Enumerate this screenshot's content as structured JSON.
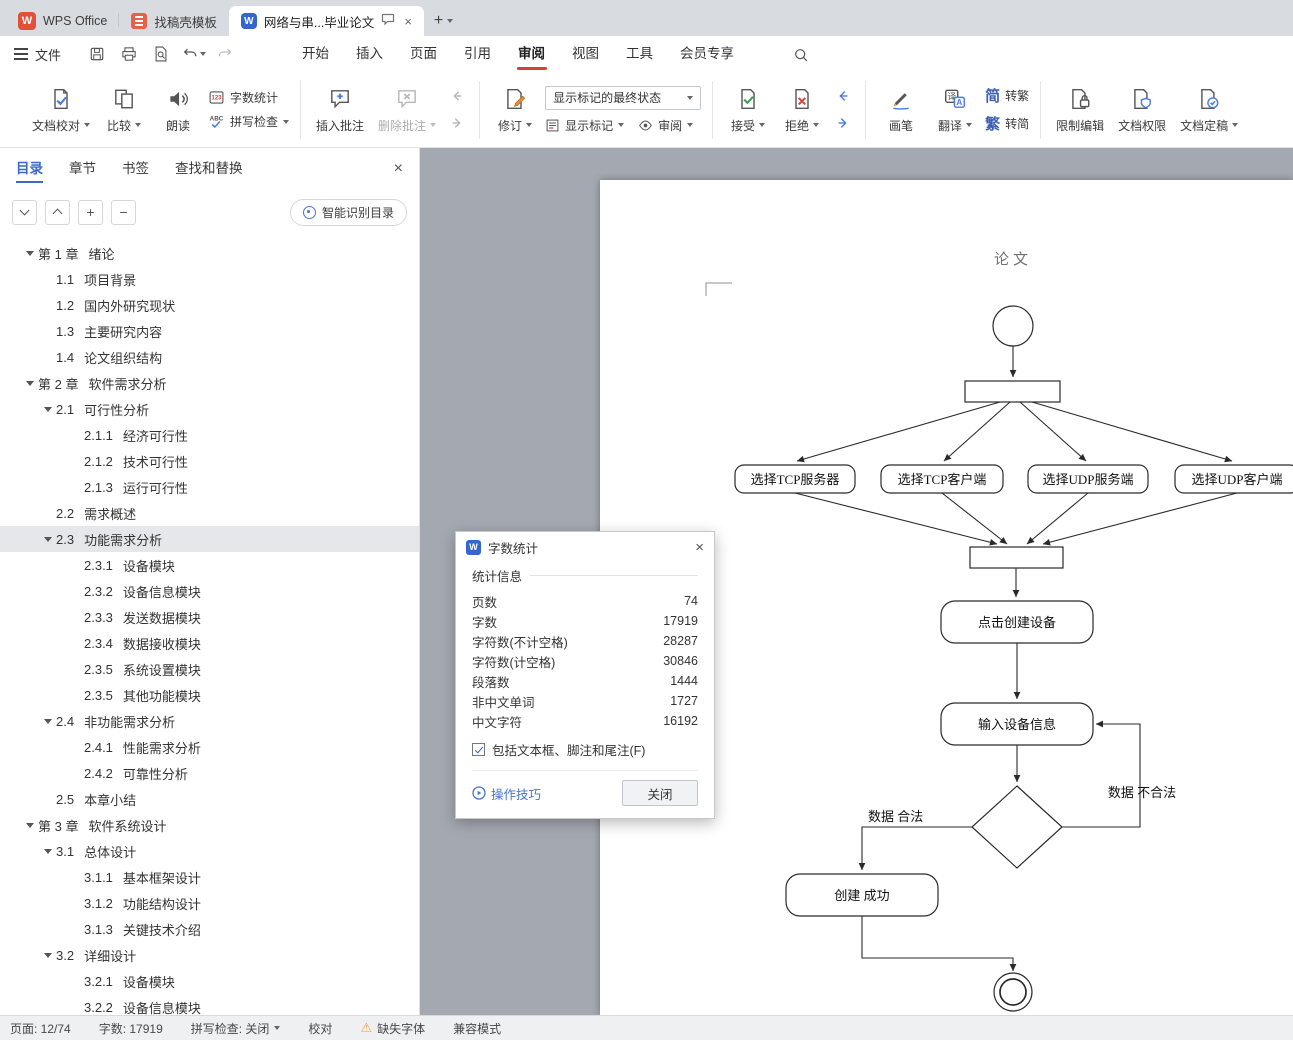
{
  "icons": {
    "w": "W",
    "abc": "ABC",
    "count": "123",
    "yi": "译",
    "a": "A",
    "warning": "⚠",
    "plus": "+",
    "minus": "−",
    "close": "×"
  },
  "tabbar": {
    "tabs": [
      {
        "label": "WPS Office"
      },
      {
        "label": "找稿壳模板"
      },
      {
        "label": "网络与串...毕业论文",
        "active": true
      }
    ]
  },
  "menubar": {
    "file": "文件",
    "items": [
      {
        "label": "开始"
      },
      {
        "label": "插入"
      },
      {
        "label": "页面"
      },
      {
        "label": "引用"
      },
      {
        "label": "审阅",
        "active": true
      },
      {
        "label": "视图"
      },
      {
        "label": "工具"
      },
      {
        "label": "会员专享"
      }
    ]
  },
  "ribbon": {
    "doc_proof": "文档校对",
    "compare": "比较",
    "read": "朗读",
    "word_count": "字数统计",
    "spell": "拼写检查",
    "insert_comment": "插入批注",
    "delete_comment": "删除批注",
    "revise": "修订",
    "markup_state": "显示标记的最终状态",
    "show_markup": "显示标记",
    "review": "审阅",
    "accept": "接受",
    "reject": "拒绝",
    "pen": "画笔",
    "translate": "翻译",
    "jian": "简",
    "fan": "繁",
    "s2t": "转繁",
    "t2s": "转简",
    "restrict": "限制编辑",
    "permission": "文档权限",
    "finalize": "文档定稿"
  },
  "sidebar": {
    "tabs": [
      {
        "label": "目录",
        "active": true
      },
      {
        "label": "章节"
      },
      {
        "label": "书签"
      },
      {
        "label": "查找和替换"
      }
    ],
    "smart_toc": "智能识别目录",
    "toc": [
      {
        "level": 1,
        "caret": true,
        "num": "第 1 章",
        "title": "绪论"
      },
      {
        "level": 2,
        "num": "1.1",
        "title": "项目背景"
      },
      {
        "level": 2,
        "num": "1.2",
        "title": "国内外研究现状"
      },
      {
        "level": 2,
        "num": "1.3",
        "title": "主要研究内容"
      },
      {
        "level": 2,
        "num": "1.4",
        "title": "论文组织结构"
      },
      {
        "level": 1,
        "caret": true,
        "num": "第 2 章",
        "title": "软件需求分析"
      },
      {
        "level": 2,
        "caret": true,
        "num": "2.1",
        "title": "可行性分析"
      },
      {
        "level": 3,
        "num": "2.1.1",
        "title": "经济可行性"
      },
      {
        "level": 3,
        "num": "2.1.2",
        "title": "技术可行性"
      },
      {
        "level": 3,
        "num": "2.1.3",
        "title": "运行可行性"
      },
      {
        "level": 2,
        "num": "2.2",
        "title": "需求概述"
      },
      {
        "level": 2,
        "caret": true,
        "selected": true,
        "num": "2.3",
        "title": "功能需求分析"
      },
      {
        "level": 3,
        "num": "2.3.1",
        "title": "设备模块"
      },
      {
        "level": 3,
        "num": "2.3.2",
        "title": "设备信息模块"
      },
      {
        "level": 3,
        "num": "2.3.3",
        "title": "发送数据模块"
      },
      {
        "level": 3,
        "num": "2.3.4",
        "title": "数据接收模块"
      },
      {
        "level": 3,
        "num": "2.3.5",
        "title": "系统设置模块"
      },
      {
        "level": 3,
        "num": "2.3.5",
        "title": "其他功能模块"
      },
      {
        "level": 2,
        "caret": true,
        "num": "2.4",
        "title": "非功能需求分析"
      },
      {
        "level": 3,
        "num": "2.4.1",
        "title": "性能需求分析"
      },
      {
        "level": 3,
        "num": "2.4.2",
        "title": "可靠性分析"
      },
      {
        "level": 2,
        "num": "2.5",
        "title": "本章小结"
      },
      {
        "level": 1,
        "caret": true,
        "num": "第 3 章",
        "title": "软件系统设计"
      },
      {
        "level": 2,
        "caret": true,
        "num": "3.1",
        "title": "总体设计"
      },
      {
        "level": 3,
        "num": "3.1.1",
        "title": "基本框架设计"
      },
      {
        "level": 3,
        "num": "3.1.2",
        "title": "功能结构设计"
      },
      {
        "level": 3,
        "num": "3.1.3",
        "title": "关键技术介绍"
      },
      {
        "level": 2,
        "caret": true,
        "num": "3.2",
        "title": "详细设计"
      },
      {
        "level": 3,
        "num": "3.2.1",
        "title": "设备模块"
      },
      {
        "level": 3,
        "num": "3.2.2",
        "title": "设备信息模块"
      }
    ]
  },
  "dialog": {
    "title": "字数统计",
    "section": "统计信息",
    "stats": [
      {
        "label": "页数",
        "value": "74"
      },
      {
        "label": "字数",
        "value": "17919"
      },
      {
        "label": "字符数(不计空格)",
        "value": "28287"
      },
      {
        "label": "字符数(计空格)",
        "value": "30846"
      },
      {
        "label": "段落数",
        "value": "1444"
      },
      {
        "label": "非中文单词",
        "value": "1727"
      },
      {
        "label": "中文字符",
        "value": "16192"
      }
    ],
    "checkbox": "包括文本框、脚注和尾注(F)",
    "checked": true,
    "tips": "操作技巧",
    "close_btn": "关闭"
  },
  "document": {
    "header": "论文",
    "flow": {
      "options": [
        "选择TCP服务器",
        "选择TCP客户端",
        "选择UDP服务端",
        "选择UDP客户端"
      ],
      "create": "点击创建设备",
      "input": "输入设备信息",
      "success": "创建 成功",
      "valid": "数据 合法",
      "invalid": "数据 不合法"
    }
  },
  "statusbar": {
    "page": "页面: 12/74",
    "words": "字数: 17919",
    "spell": "拼写检查: 关闭",
    "proof": "校对",
    "missing_font": "缺失字体",
    "compat": "兼容模式"
  }
}
